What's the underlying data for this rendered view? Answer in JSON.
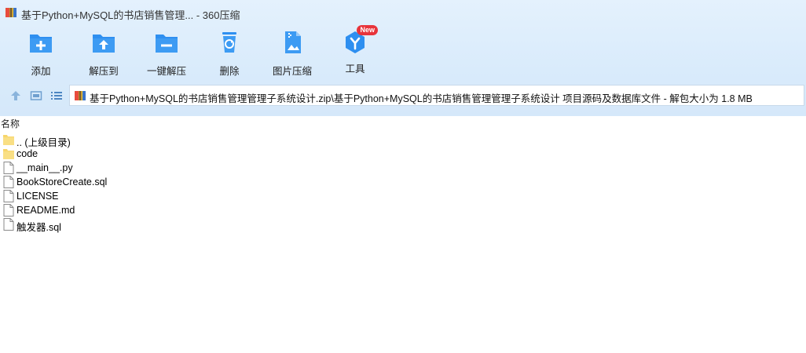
{
  "window": {
    "title": "基于Python+MySQL的书店销售管理... - 360压缩"
  },
  "toolbar": {
    "buttons": [
      {
        "label": "添加",
        "icon": "add-icon"
      },
      {
        "label": "解压到",
        "icon": "extract-to-icon"
      },
      {
        "label": "一键解压",
        "icon": "one-click-extract-icon"
      },
      {
        "label": "删除",
        "icon": "delete-icon"
      },
      {
        "label": "图片压缩",
        "icon": "image-compress-icon"
      },
      {
        "label": "工具",
        "icon": "tools-icon",
        "badge": "New"
      }
    ]
  },
  "address": {
    "path": "基于Python+MySQL的书店销售管理管理子系统设计.zip\\基于Python+MySQL的书店销售管理管理子系统设计 项目源码及数据库文件 - 解包大小为 1.8 MB"
  },
  "columns": {
    "name": "名称"
  },
  "files": [
    {
      "name": ".. (上级目录)",
      "type": "folder"
    },
    {
      "name": "code",
      "type": "folder"
    },
    {
      "name": "__main__.py",
      "type": "file"
    },
    {
      "name": "BookStoreCreate.sql",
      "type": "file"
    },
    {
      "name": "LICENSE",
      "type": "file"
    },
    {
      "name": "README.md",
      "type": "file"
    },
    {
      "name": "触发器.sql",
      "type": "file"
    }
  ],
  "colors": {
    "accent": "#2e8ff0",
    "header_bg": "#dcecfb",
    "badge": "#e8343b",
    "folder": "#f7d56b"
  }
}
